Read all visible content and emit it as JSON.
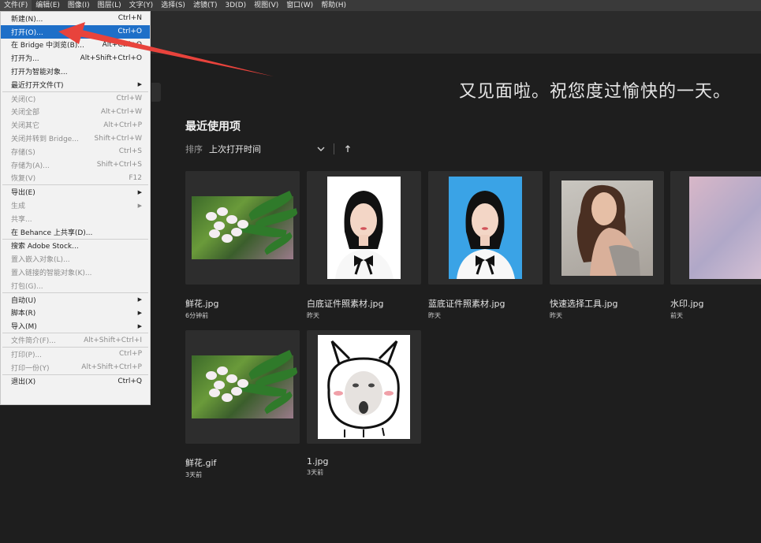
{
  "menubar": {
    "items": [
      "文件(F)",
      "编辑(E)",
      "图像(I)",
      "图层(L)",
      "文字(Y)",
      "选择(S)",
      "滤镜(T)",
      "3D(D)",
      "视图(V)",
      "窗口(W)",
      "帮助(H)"
    ]
  },
  "home": {
    "greeting": "又见面啦。祝您度过愉快的一天。",
    "recent_title": "最近使用项",
    "sort_label": "排序",
    "sort_value": "上次打开时间"
  },
  "recent_files": [
    {
      "name": "鲜花.jpg",
      "time": "6分钟前",
      "thumb": "flower"
    },
    {
      "name": "白底证件照素材.jpg",
      "time": "昨天",
      "thumb": "portrait-white"
    },
    {
      "name": "蓝底证件照素材.jpg",
      "time": "昨天",
      "thumb": "portrait-blue"
    },
    {
      "name": "快速选择工具.jpg",
      "time": "昨天",
      "thumb": "woman"
    },
    {
      "name": "水印.jpg",
      "time": "前天",
      "thumb": "watermark"
    },
    {
      "name": "鲜花.gif",
      "time": "3天前",
      "thumb": "flower"
    },
    {
      "name": "1.jpg",
      "time": "3天前",
      "thumb": "cartoon"
    }
  ],
  "file_menu": [
    {
      "label": "新建(N)...",
      "shortcut": "Ctrl+N",
      "enabled": true
    },
    {
      "label": "打开(O)...",
      "shortcut": "Ctrl+O",
      "enabled": true,
      "highlighted": true
    },
    {
      "label": "在 Bridge 中浏览(B)...",
      "shortcut": "Alt+Ctrl+O",
      "enabled": true
    },
    {
      "label": "打开为...",
      "shortcut": "Alt+Shift+Ctrl+O",
      "enabled": true
    },
    {
      "label": "打开为智能对象...",
      "shortcut": "",
      "enabled": true
    },
    {
      "label": "最近打开文件(T)",
      "shortcut": "",
      "enabled": true,
      "submenu": true
    },
    {
      "separator": true
    },
    {
      "label": "关闭(C)",
      "shortcut": "Ctrl+W",
      "enabled": false
    },
    {
      "label": "关闭全部",
      "shortcut": "Alt+Ctrl+W",
      "enabled": false
    },
    {
      "label": "关闭其它",
      "shortcut": "Alt+Ctrl+P",
      "enabled": false
    },
    {
      "label": "关闭并转到 Bridge...",
      "shortcut": "Shift+Ctrl+W",
      "enabled": false
    },
    {
      "label": "存储(S)",
      "shortcut": "Ctrl+S",
      "enabled": false
    },
    {
      "label": "存储为(A)...",
      "shortcut": "Shift+Ctrl+S",
      "enabled": false
    },
    {
      "label": "恢复(V)",
      "shortcut": "F12",
      "enabled": false
    },
    {
      "separator": true
    },
    {
      "label": "导出(E)",
      "shortcut": "",
      "enabled": true,
      "submenu": true
    },
    {
      "label": "生成",
      "shortcut": "",
      "enabled": false,
      "submenu": true
    },
    {
      "label": "共享...",
      "shortcut": "",
      "enabled": false
    },
    {
      "label": "在 Behance 上共享(D)...",
      "shortcut": "",
      "enabled": true
    },
    {
      "separator": true
    },
    {
      "label": "搜索 Adobe Stock...",
      "shortcut": "",
      "enabled": true
    },
    {
      "label": "置入嵌入对象(L)...",
      "shortcut": "",
      "enabled": false
    },
    {
      "label": "置入链接的智能对象(K)...",
      "shortcut": "",
      "enabled": false
    },
    {
      "label": "打包(G)...",
      "shortcut": "",
      "enabled": false
    },
    {
      "separator": true
    },
    {
      "label": "自动(U)",
      "shortcut": "",
      "enabled": true,
      "submenu": true
    },
    {
      "label": "脚本(R)",
      "shortcut": "",
      "enabled": true,
      "submenu": true
    },
    {
      "label": "导入(M)",
      "shortcut": "",
      "enabled": true,
      "submenu": true
    },
    {
      "separator": true
    },
    {
      "label": "文件简介(F)...",
      "shortcut": "Alt+Shift+Ctrl+I",
      "enabled": false
    },
    {
      "separator": true
    },
    {
      "label": "打印(P)...",
      "shortcut": "Ctrl+P",
      "enabled": false
    },
    {
      "label": "打印一份(Y)",
      "shortcut": "Alt+Shift+Ctrl+P",
      "enabled": false
    },
    {
      "separator": true
    },
    {
      "label": "退出(X)",
      "shortcut": "Ctrl+Q",
      "enabled": true
    }
  ],
  "colors": {
    "background": "#1e1e1e",
    "menu_highlight": "#1e6fc8",
    "annotation_arrow": "#e8433c"
  }
}
